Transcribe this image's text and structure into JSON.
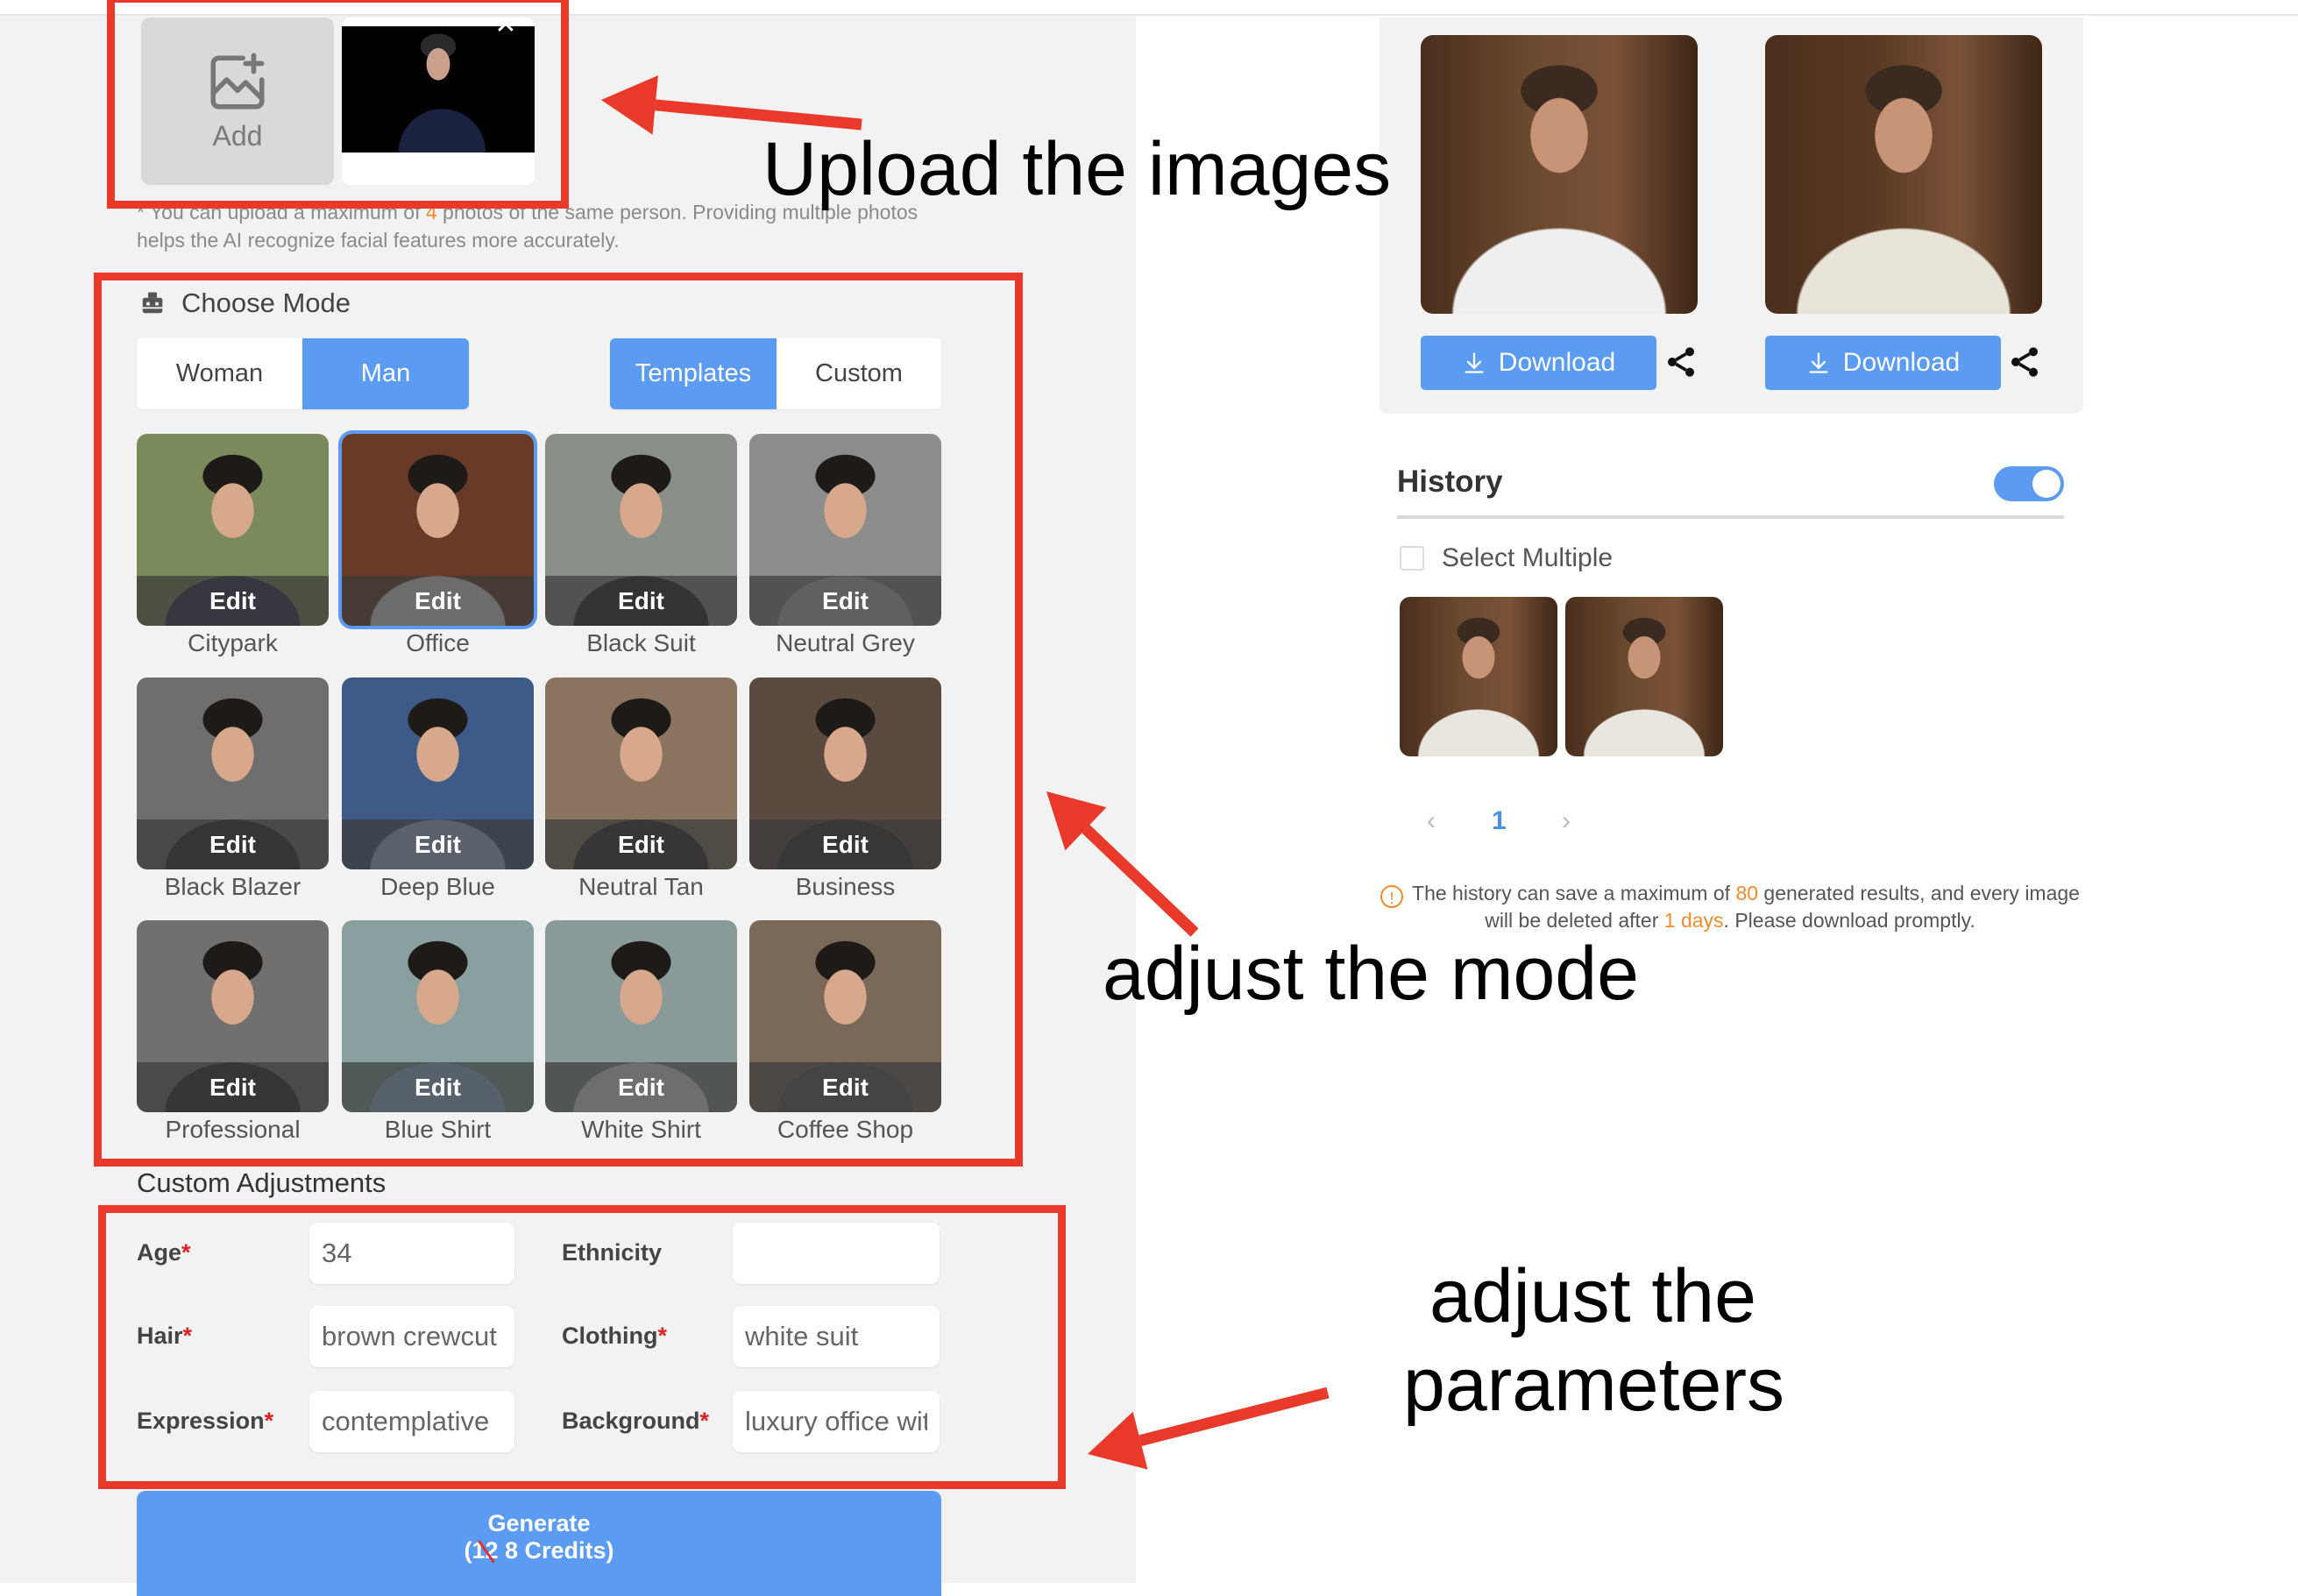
{
  "upload": {
    "add_label": "Add",
    "close_label": "✕",
    "hint_prefix": "* You can upload a maximum of ",
    "hint_count": "4",
    "hint_suffix": " photos of the same person. Providing multiple photos helps the AI recognize facial features more accurately."
  },
  "mode": {
    "title": "Choose Mode",
    "gender_options": [
      "Woman",
      "Man"
    ],
    "gender_selected": "Man",
    "type_options": [
      "Templates",
      "Custom"
    ],
    "type_selected": "Templates",
    "templates": [
      {
        "label": "Citypark",
        "edit": "Edit",
        "bg": "#7a8a5a",
        "suit": "#2b2d4a",
        "selected": false
      },
      {
        "label": "Office",
        "edit": "Edit",
        "bg": "#6a3a28",
        "suit": "#e8e8e8",
        "selected": true
      },
      {
        "label": "Black Suit",
        "edit": "Edit",
        "bg": "#8a8e88",
        "suit": "#1e1e1e",
        "selected": false
      },
      {
        "label": "Neutral Grey",
        "edit": "Edit",
        "bg": "#8c8c8c",
        "suit": "#bdbdbd",
        "selected": false
      },
      {
        "label": "Black Blazer",
        "edit": "Edit",
        "bg": "#6e6e6e",
        "suit": "#262626",
        "selected": false
      },
      {
        "label": "Deep Blue",
        "edit": "Edit",
        "bg": "#3e5a86",
        "suit": "#a9c3e6",
        "selected": false
      },
      {
        "label": "Neutral Tan",
        "edit": "Edit",
        "bg": "#8a7460",
        "suit": "#2a2a2a",
        "selected": false
      },
      {
        "label": "Business",
        "edit": "Edit",
        "bg": "#5a4a40",
        "suit": "#2e2e2e",
        "selected": false
      },
      {
        "label": "Professional",
        "edit": "Edit",
        "bg": "#707070",
        "suit": "#2a2a2a",
        "selected": false
      },
      {
        "label": "Blue Shirt",
        "edit": "Edit",
        "bg": "#8aa0a0",
        "suit": "#9ec0e8",
        "selected": false
      },
      {
        "label": "White Shirt",
        "edit": "Edit",
        "bg": "#8a9a98",
        "suit": "#efefef",
        "selected": false
      },
      {
        "label": "Coffee Shop",
        "edit": "Edit",
        "bg": "#7a6858",
        "suit": "#5a5a5a",
        "selected": false
      }
    ]
  },
  "adjustments": {
    "title": "Custom Adjustments",
    "fields": [
      {
        "label": "Age",
        "required": true,
        "value": "34"
      },
      {
        "label": "Ethnicity",
        "required": false,
        "value": ""
      },
      {
        "label": "Hair",
        "required": true,
        "value": "brown crewcut"
      },
      {
        "label": "Clothing",
        "required": true,
        "value": "white suit"
      },
      {
        "label": "Expression",
        "required": true,
        "value": "contemplative"
      },
      {
        "label": "Background",
        "required": true,
        "value": "luxury office with wood paneling"
      }
    ],
    "required_mark": "*"
  },
  "generate": {
    "label": "Generate",
    "credits_open": "(",
    "credits_old": "12",
    "credits_new": " 8 Credits)"
  },
  "results": {
    "download_label": "Download",
    "items": [
      {
        "name": "result-1"
      },
      {
        "name": "result-2"
      }
    ]
  },
  "history": {
    "title": "History",
    "toggle_on": true,
    "select_multiple": "Select Multiple",
    "thumbnails": 2,
    "pagination": {
      "prev": "‹",
      "current": "1",
      "next": "›"
    },
    "notice": {
      "part1": "The history can save a maximum of ",
      "max": "80",
      "part2": " generated results, and every image will be deleted after ",
      "days": "1 days",
      "part3": ". Please download promptly."
    }
  },
  "annotations": {
    "upload": "Upload the images",
    "mode": "adjust the mode",
    "params_line1": "adjust the",
    "params_line2": "parameters",
    "color": "#e8392a"
  },
  "colors": {
    "accent": "#5b9bf2",
    "panel_bg": "#f2f2f2",
    "highlight": "#f08c2e",
    "required": "#e02020"
  }
}
